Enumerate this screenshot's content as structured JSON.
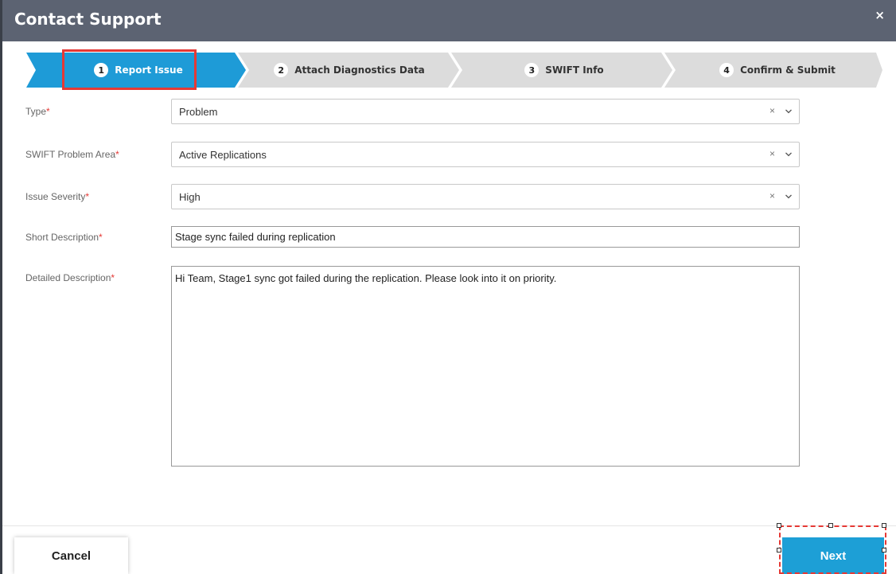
{
  "dialog": {
    "title": "Contact Support",
    "close_glyph": "×"
  },
  "stepper": {
    "steps": [
      {
        "num": "1",
        "label": "Report Issue",
        "active": true
      },
      {
        "num": "2",
        "label": "Attach Diagnostics Data",
        "active": false
      },
      {
        "num": "3",
        "label": "SWIFT Info",
        "active": false
      },
      {
        "num": "4",
        "label": "Confirm & Submit",
        "active": false
      }
    ],
    "active_color": "#1e9bd7",
    "inactive_color": "#dcdcdc"
  },
  "form": {
    "type": {
      "label": "Type",
      "required_mark": "*",
      "value": "Problem"
    },
    "problem_area": {
      "label": "SWIFT Problem Area",
      "required_mark": "*",
      "value": "Active Replications"
    },
    "severity": {
      "label": "Issue Severity",
      "required_mark": "*",
      "value": "High"
    },
    "short_description": {
      "label": "Short Description",
      "required_mark": "*",
      "value": "Stage sync failed during replication"
    },
    "detailed_description": {
      "label": "Detailed Description",
      "required_mark": "*",
      "value": "Hi Team, Stage1 sync got failed during the replication. Please look into it on priority."
    },
    "clear_glyph": "×"
  },
  "footer": {
    "cancel_label": "Cancel",
    "next_label": "Next"
  },
  "colors": {
    "header_bg": "#5c6372",
    "accent": "#1d9fd6",
    "required": "#e53935"
  }
}
